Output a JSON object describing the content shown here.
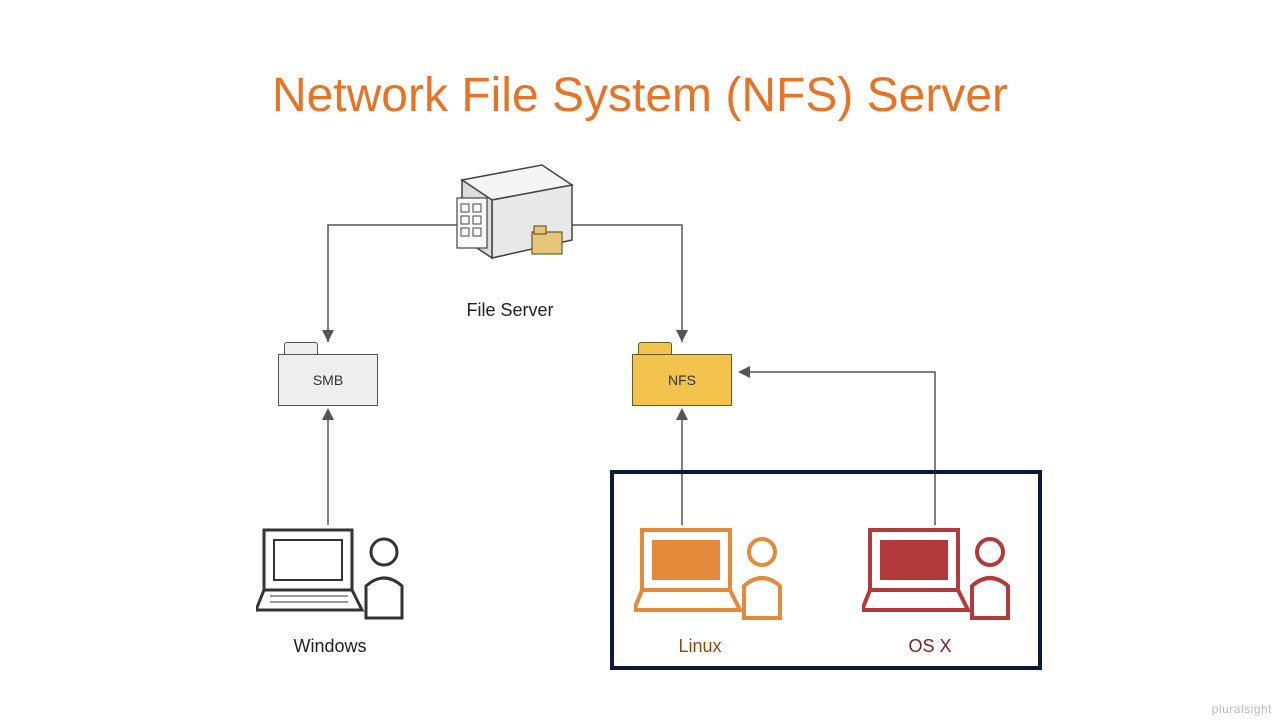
{
  "title": "Network File System (NFS) Server",
  "nodes": {
    "server_label": "File Server",
    "smb_label": "SMB",
    "nfs_label": "NFS",
    "windows_label": "Windows",
    "linux_label": "Linux",
    "osx_label": "OS X"
  },
  "colors": {
    "title": "#e67326",
    "smb_fill": "#eeeeee",
    "nfs_fill": "#f3c44d",
    "linux_accent": "#e58a3a",
    "osx_accent": "#b33a3a",
    "windows_accent": "#333333",
    "highlight_border": "#0b1a3a"
  },
  "watermark": "pluralsight"
}
